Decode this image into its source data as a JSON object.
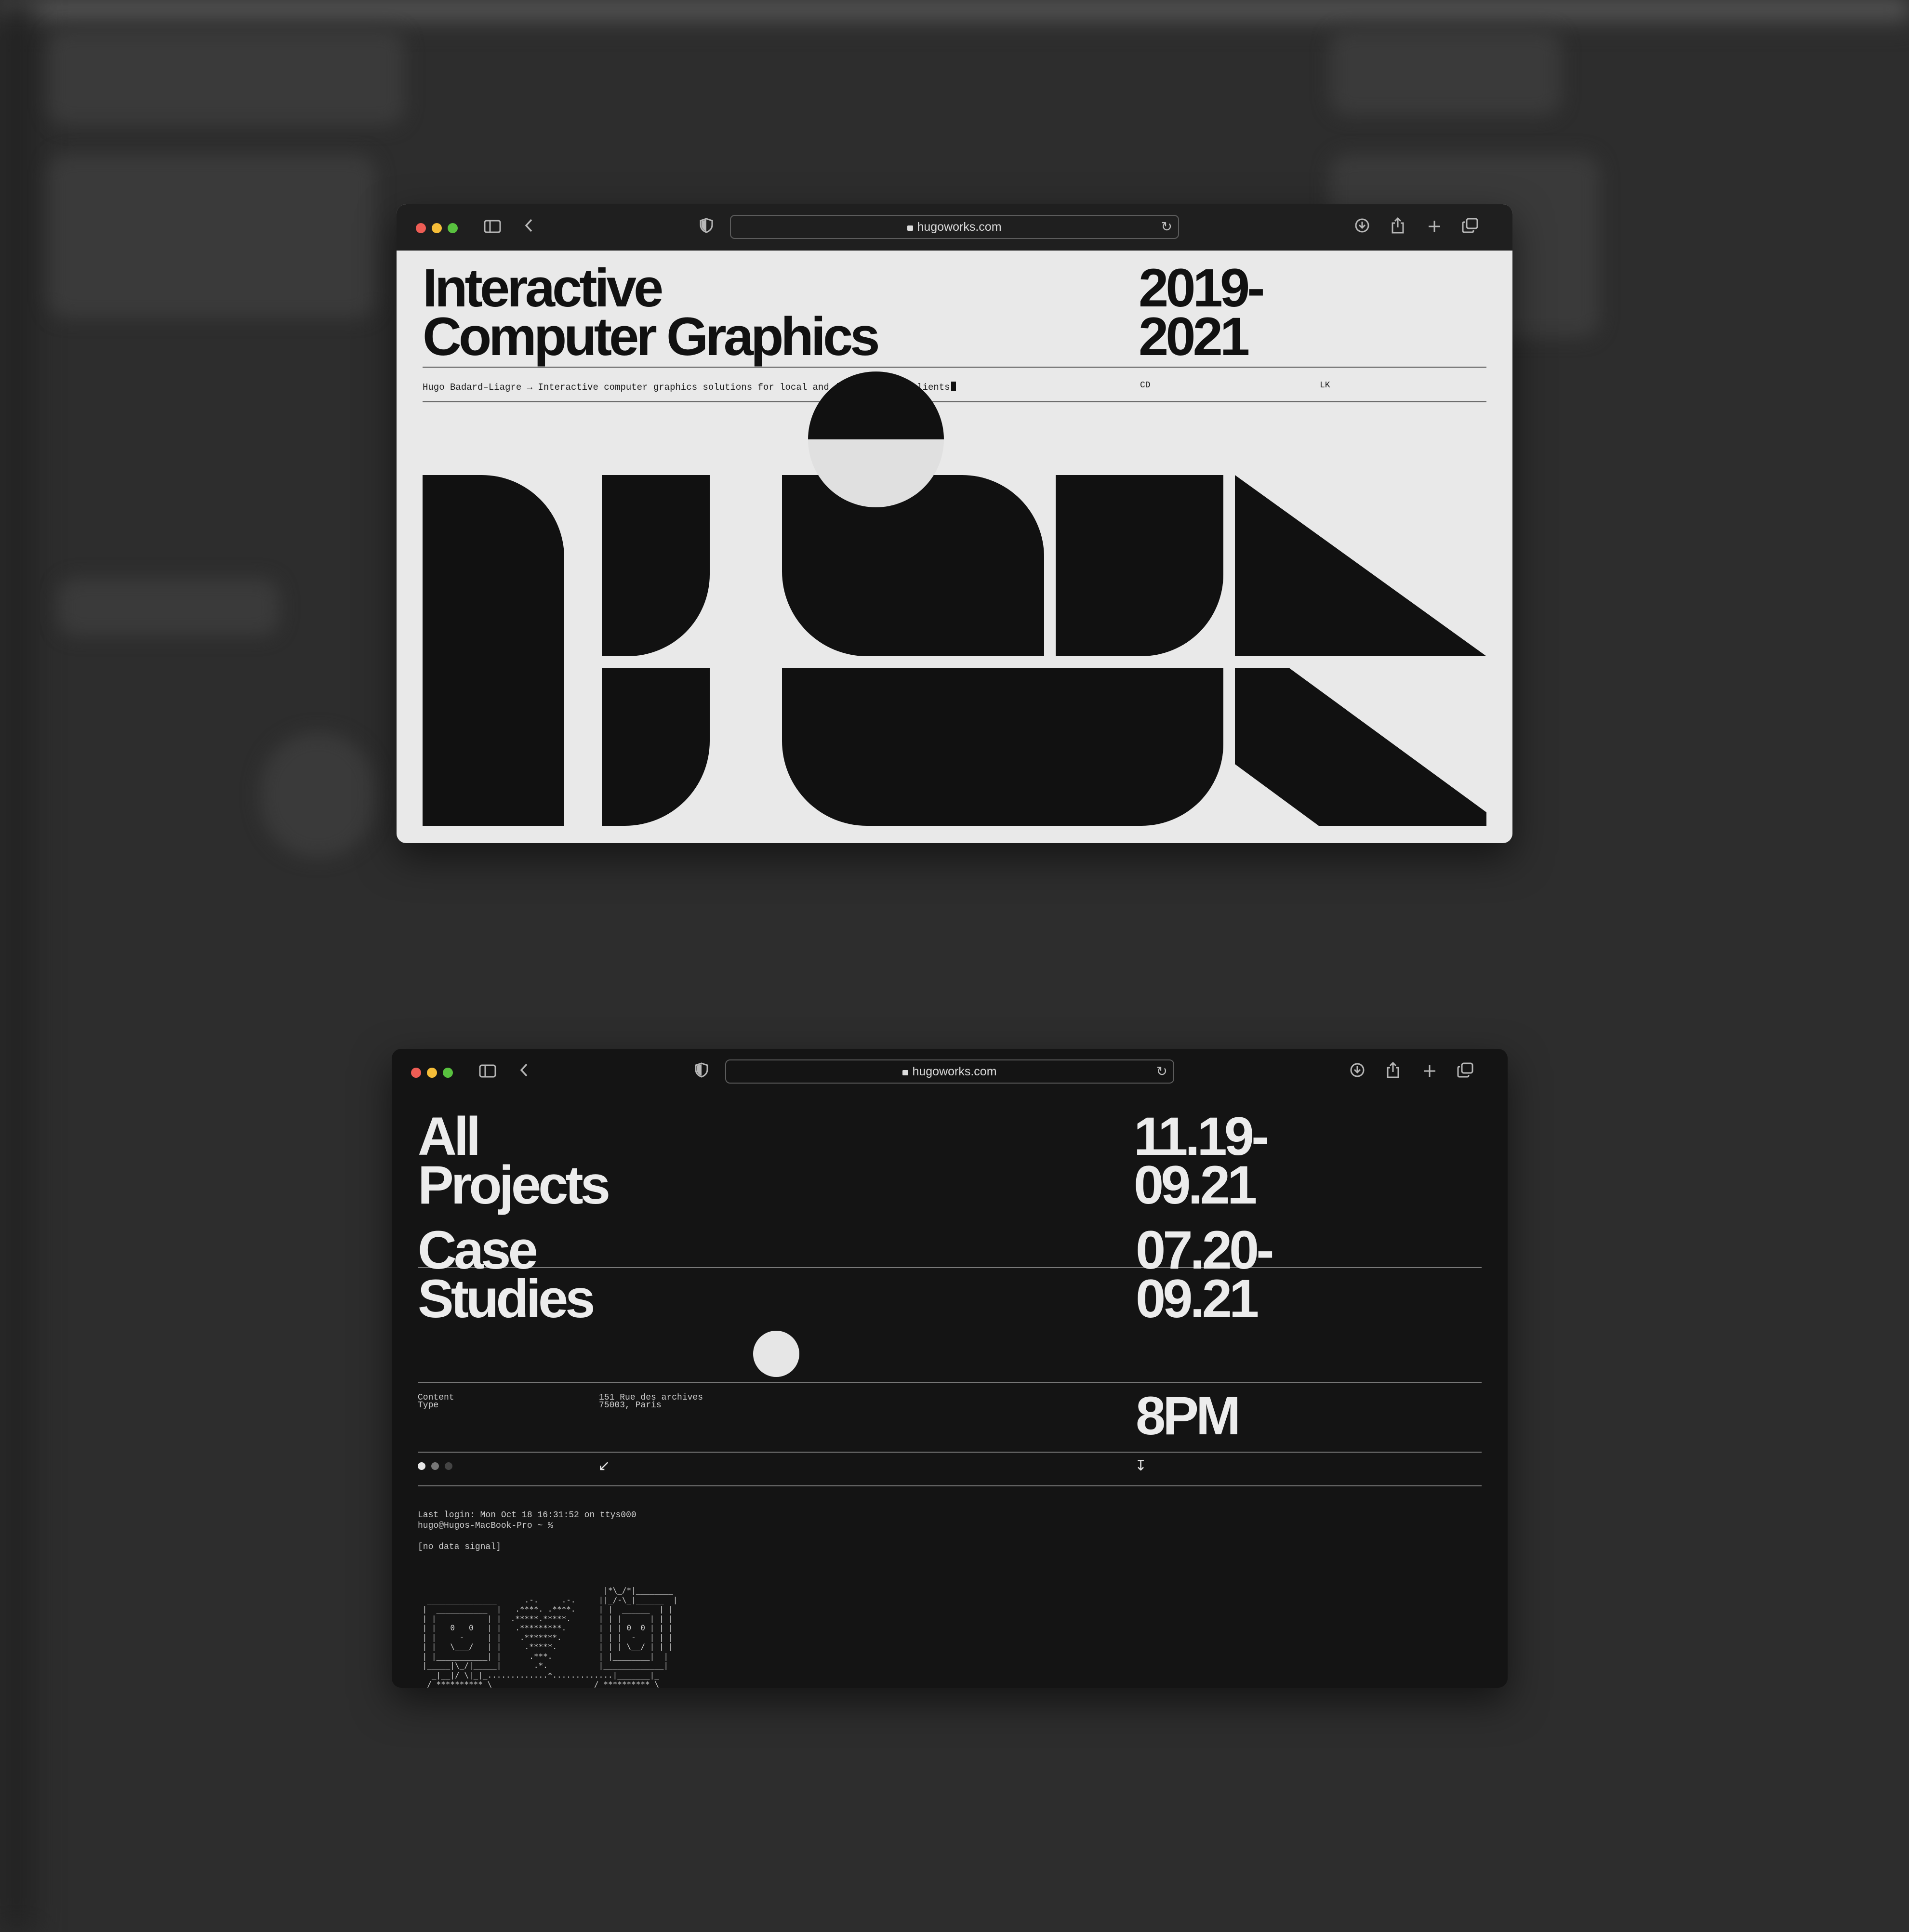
{
  "browser": {
    "url": "hugoworks.com"
  },
  "light_page": {
    "title_line1": "Interactive",
    "title_line2": "Computer Graphics",
    "years_line1": "2019-",
    "years_line2": "2021",
    "subtitle": "Hugo Badard–Liagre → Interactive computer graphics solutions for local and international clients",
    "col_cd": "CD",
    "col_lk": "LK"
  },
  "dark_page": {
    "row1_title_line1": "All",
    "row1_title_line2": "Projects",
    "row1_date_line1": "11.19-",
    "row1_date_line2": "09.21",
    "row2_title_line1": "Case",
    "row2_title_line2": "Studies",
    "row2_date_line1": "07.20-",
    "row2_date_line2": "09.21",
    "meta_label_line1": "Content",
    "meta_label_line2": "Type",
    "address_line1": "151 Rue des archives",
    "address_line2": "75003, Paris",
    "time": "8PM",
    "nav_left_arrow": "↙",
    "nav_down_arrow": "↧",
    "terminal_line1": "Last login: Mon Oct 18 16:31:52 on ttys000",
    "terminal_line2": "hugo@Hugos-MacBook-Pro ~ %",
    "terminal_line3": "[no data signal]"
  },
  "icons": {
    "sidebar": "sidebar-icon",
    "back": "chevron-left-icon",
    "shield": "shield-icon",
    "download": "download-icon",
    "share": "share-icon",
    "new_tab": "plus-icon",
    "tabs": "tabs-icon"
  },
  "colors": {
    "light_bg": "#e9e9e9",
    "dark_bg": "#141414",
    "ink": "#111111"
  }
}
